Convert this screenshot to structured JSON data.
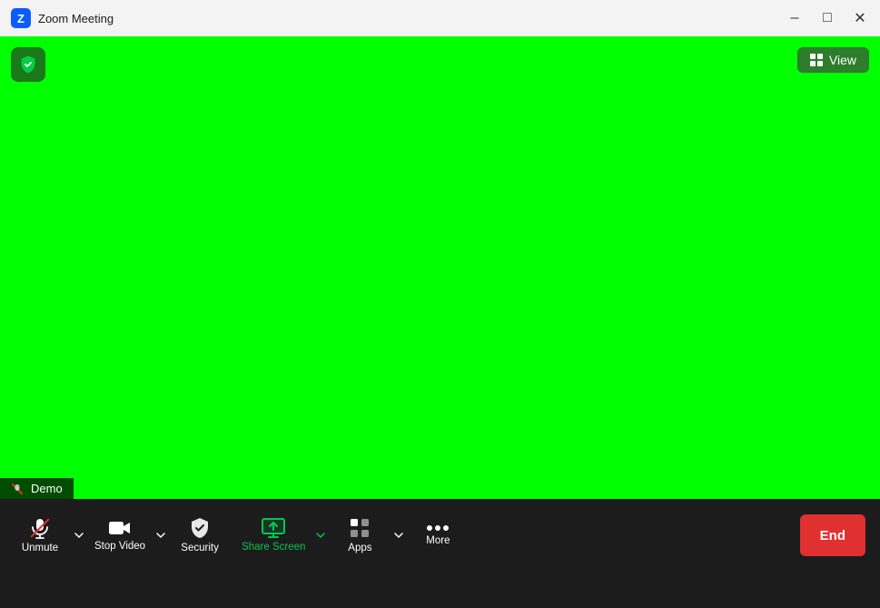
{
  "window": {
    "title": "Zoom Meeting",
    "logo_letter": "Z",
    "minimize_label": "minimize",
    "maximize_label": "maximize",
    "close_label": "close"
  },
  "meeting": {
    "background_color": "#00ff00",
    "view_button_label": "View",
    "demo_label": "Demo"
  },
  "toolbar": {
    "unmute_label": "Unmute",
    "stop_video_label": "Stop Video",
    "security_label": "Security",
    "share_screen_label": "Share Screen",
    "apps_label": "Apps",
    "more_label": "More",
    "end_label": "End"
  }
}
